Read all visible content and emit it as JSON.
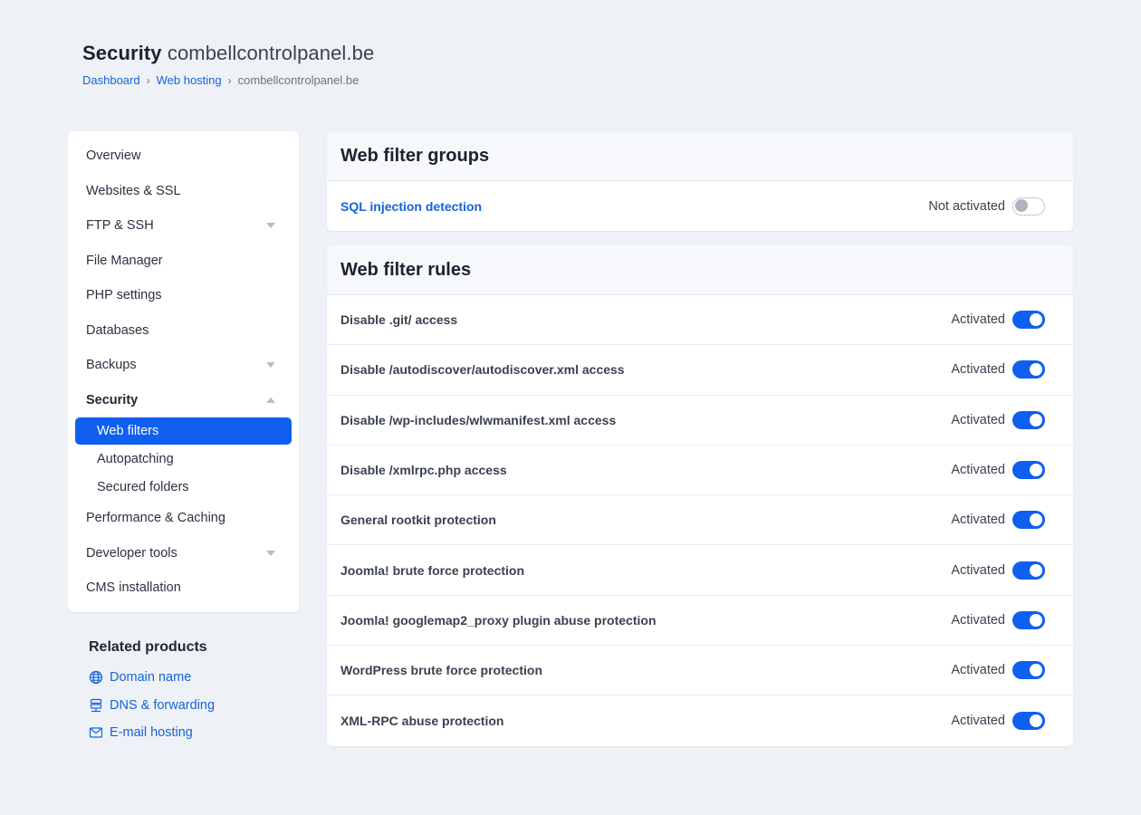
{
  "header": {
    "title": "Security",
    "domain": "combellcontrolpanel.be",
    "breadcrumb": [
      {
        "label": "Dashboard"
      },
      {
        "label": "Web hosting"
      },
      {
        "label": "combellcontrolpanel.be"
      }
    ]
  },
  "sidebar": {
    "items": [
      {
        "label": "Overview"
      },
      {
        "label": "Websites & SSL"
      },
      {
        "label": "FTP & SSH"
      },
      {
        "label": "File Manager"
      },
      {
        "label": "PHP settings"
      },
      {
        "label": "Databases"
      },
      {
        "label": "Backups"
      },
      {
        "label": "Security"
      },
      {
        "label": "Performance & Caching"
      },
      {
        "label": "Developer tools"
      },
      {
        "label": "CMS installation"
      }
    ],
    "security_sub": [
      {
        "label": "Web filters"
      },
      {
        "label": "Autopatching"
      },
      {
        "label": "Secured folders"
      }
    ]
  },
  "related": {
    "title": "Related products",
    "links": [
      {
        "label": "Domain name",
        "icon": "globe-icon"
      },
      {
        "label": "DNS & forwarding",
        "icon": "dns-icon"
      },
      {
        "label": "E-mail hosting",
        "icon": "mail-icon"
      }
    ]
  },
  "groups": {
    "title": "Web filter groups",
    "rows": [
      {
        "label": "SQL injection detection",
        "status": "Not activated",
        "enabled": false
      }
    ]
  },
  "rules": {
    "title": "Web filter rules",
    "rows": [
      {
        "label": "Disable .git/ access",
        "status": "Activated",
        "enabled": true
      },
      {
        "label": "Disable /autodiscover/autodiscover.xml access",
        "status": "Activated",
        "enabled": true
      },
      {
        "label": "Disable /wp-includes/wlwmanifest.xml access",
        "status": "Activated",
        "enabled": true
      },
      {
        "label": "Disable /xmlrpc.php access",
        "status": "Activated",
        "enabled": true
      },
      {
        "label": "General rootkit protection",
        "status": "Activated",
        "enabled": true
      },
      {
        "label": "Joomla! brute force protection",
        "status": "Activated",
        "enabled": true
      },
      {
        "label": "Joomla! googlemap2_proxy plugin abuse protection",
        "status": "Activated",
        "enabled": true
      },
      {
        "label": "WordPress brute force protection",
        "status": "Activated",
        "enabled": true
      },
      {
        "label": "XML-RPC abuse protection",
        "status": "Activated",
        "enabled": true
      }
    ]
  },
  "colors": {
    "accent": "#0f5ff1",
    "link": "#1563d9",
    "background": "#eef2f6"
  }
}
